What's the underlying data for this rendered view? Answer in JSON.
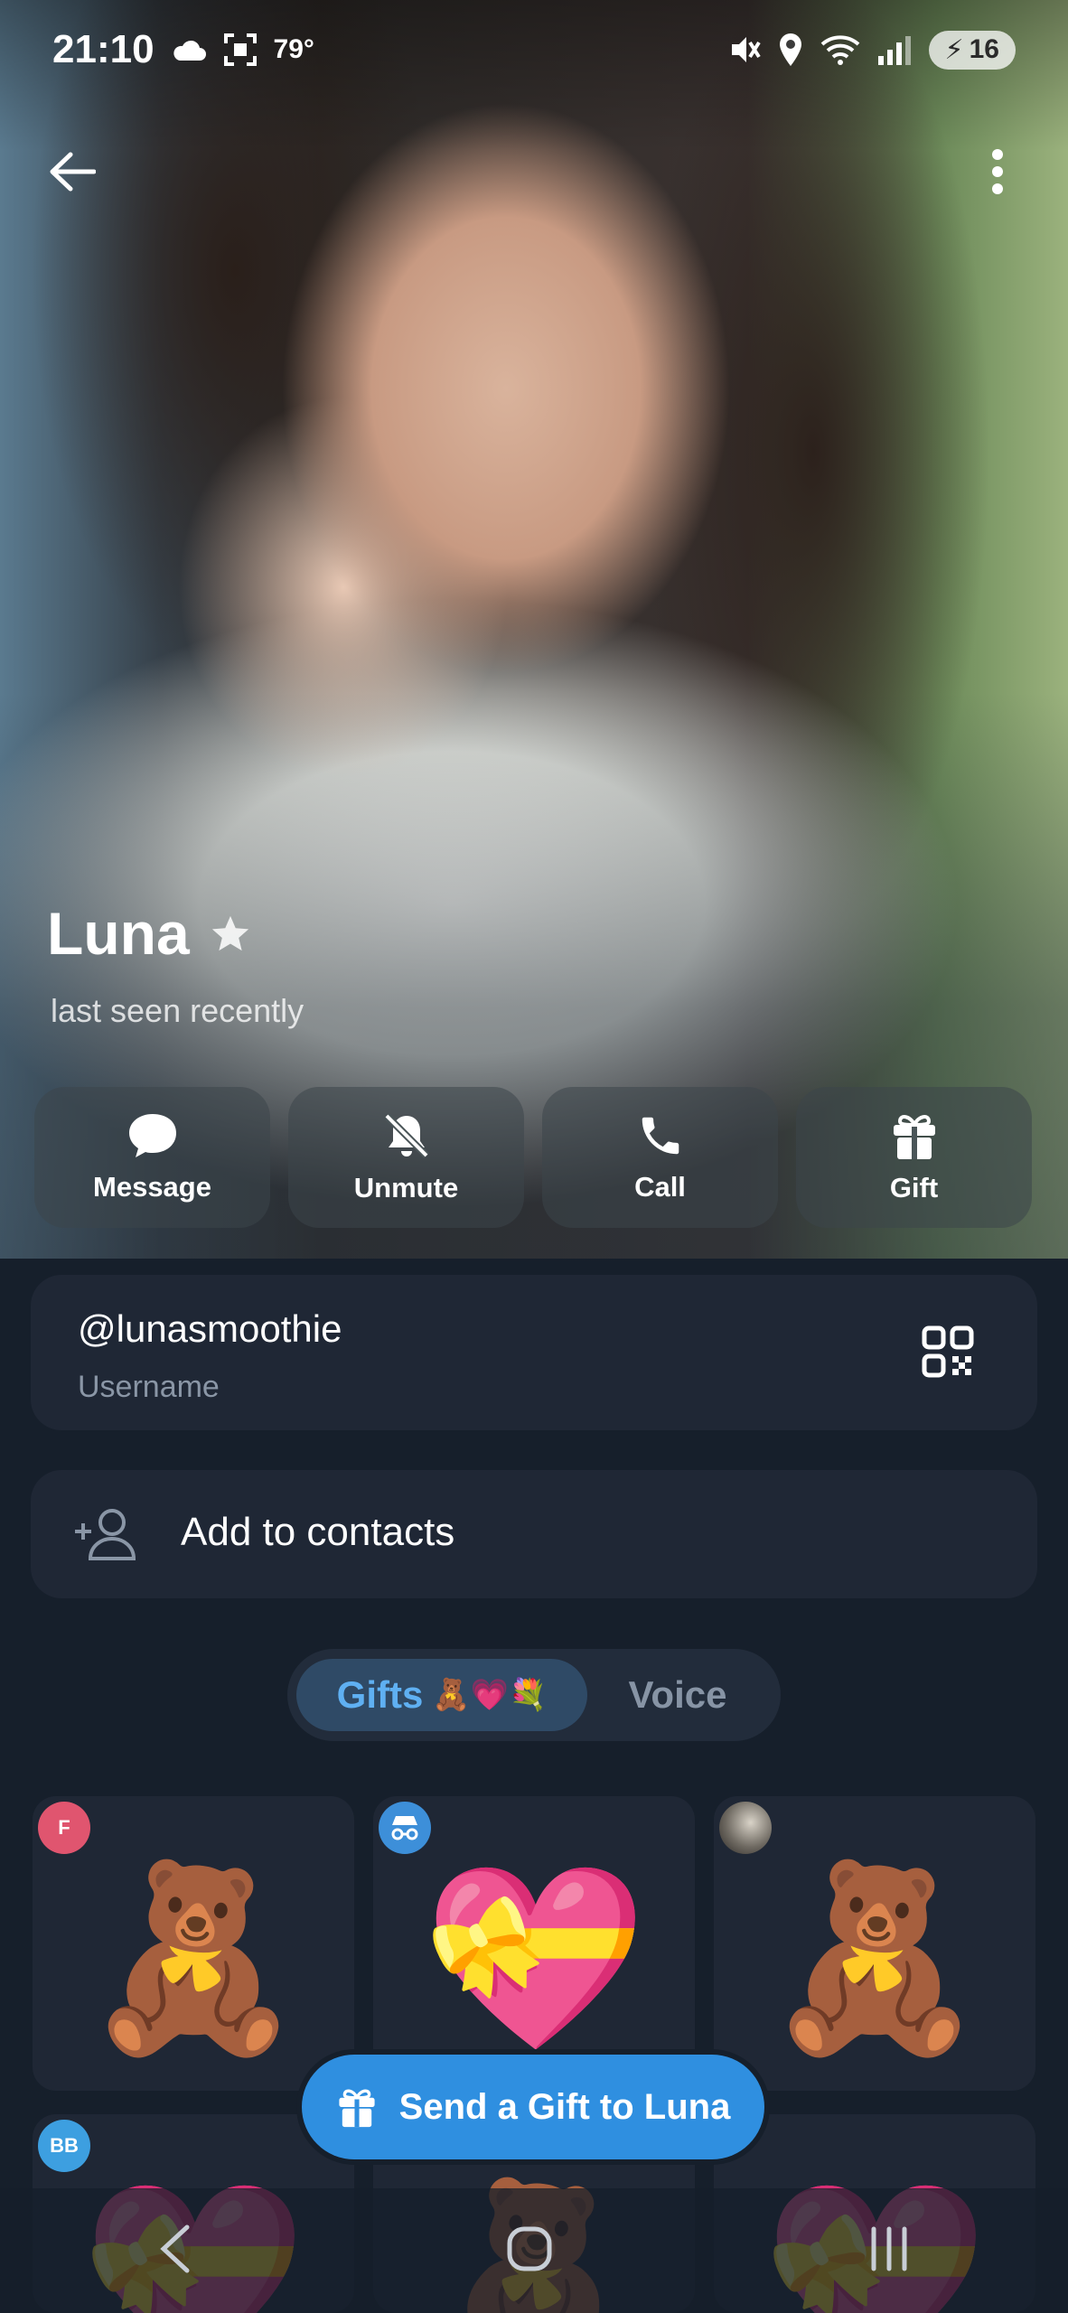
{
  "status_bar": {
    "time": "21:10",
    "temperature": "79°",
    "battery": "16"
  },
  "profile": {
    "name": "Luna",
    "status": "last seen recently"
  },
  "actions": [
    {
      "label": "Message",
      "icon": "message-icon"
    },
    {
      "label": "Unmute",
      "icon": "bell-off-icon"
    },
    {
      "label": "Call",
      "icon": "phone-icon"
    },
    {
      "label": "Gift",
      "icon": "gift-icon"
    }
  ],
  "username": {
    "value": "@lunasmoothie",
    "caption": "Username"
  },
  "contacts": {
    "label": "Add to contacts"
  },
  "tabs": {
    "gifts_label": "Gifts",
    "gifts_emoji": "🧸💗💐",
    "voice_label": "Voice"
  },
  "gifts": [
    {
      "avatar": "F",
      "emoji": "🧸"
    },
    {
      "avatar": "",
      "emoji": "💝"
    },
    {
      "avatar": "",
      "emoji": "🧸"
    },
    {
      "avatar": "BB",
      "emoji": "💝"
    },
    {
      "avatar": "",
      "emoji": "🧸"
    },
    {
      "avatar": "",
      "emoji": "💝"
    }
  ],
  "send_gift": {
    "label": "Send a Gift to Luna"
  },
  "colors": {
    "accent": "#2f8fe0",
    "tab_active_text": "#5fb0f2",
    "card_bg": "#1f2735",
    "page_bg": "#161f2b"
  }
}
